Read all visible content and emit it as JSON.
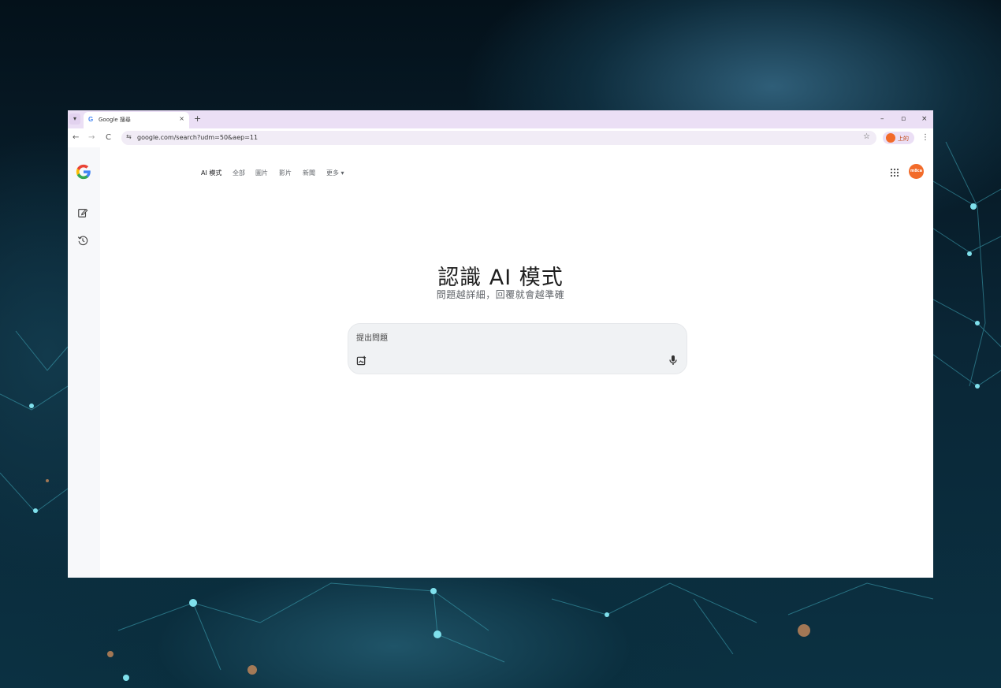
{
  "browser": {
    "tab_title": "Google 搜尋",
    "tab_favicon": "G",
    "tab_close": "×",
    "new_tab": "+",
    "tab_menu": "▾",
    "url": "google.com/search?udm=50&aep=11",
    "window_controls": {
      "minimize": "–",
      "restore": "▫",
      "close": "×"
    },
    "nav": {
      "back": "←",
      "forward": "→",
      "reload": "C"
    },
    "site_info": "⇆",
    "bookmark": "☆",
    "profile_label": "上的",
    "menu": "⋮"
  },
  "nav_tabs": [
    {
      "label": "AI 模式",
      "active": true
    },
    {
      "label": "全部",
      "active": false
    },
    {
      "label": "圖片",
      "active": false
    },
    {
      "label": "影片",
      "active": false
    },
    {
      "label": "新聞",
      "active": false
    },
    {
      "label": "更多 ▾",
      "active": false
    }
  ],
  "hero": {
    "title": "認識 AI 模式",
    "subtitle": "問題越詳細，回覆就會越準確"
  },
  "search": {
    "placeholder": "提出問題",
    "value": ""
  },
  "avatar_text": "m8ca",
  "icons": {
    "logo": "google-g-logo",
    "new_chat": "edit-icon",
    "history": "history-icon",
    "apps": "apps-grid-icon",
    "upload": "image-upload-icon",
    "mic": "mic-icon"
  },
  "colors": {
    "tabbar": "#ebdff5",
    "accent_orange": "#f26b2a",
    "search_bg": "#f0f2f4"
  }
}
